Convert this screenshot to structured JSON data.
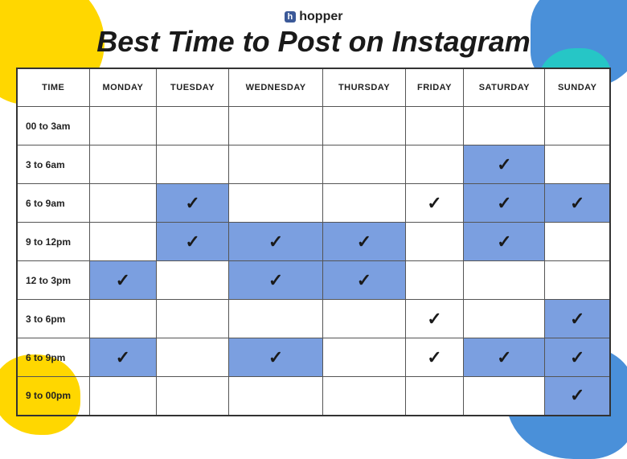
{
  "brand": {
    "icon_label": "h",
    "name": "hopper"
  },
  "title": "Best Time to Post on Instagram",
  "table": {
    "headers": [
      "TIME",
      "MONDAY",
      "TUESDAY",
      "WEDNESDAY",
      "THURSDAY",
      "FRIDAY",
      "SATURDAY",
      "SUNDAY"
    ],
    "rows": [
      {
        "time": "00 to 3am",
        "cells": [
          {
            "highlight": false,
            "check": false
          },
          {
            "highlight": false,
            "check": false
          },
          {
            "highlight": false,
            "check": false
          },
          {
            "highlight": false,
            "check": false
          },
          {
            "highlight": false,
            "check": false
          },
          {
            "highlight": false,
            "check": false
          },
          {
            "highlight": false,
            "check": false
          }
        ]
      },
      {
        "time": "3 to 6am",
        "cells": [
          {
            "highlight": false,
            "check": false
          },
          {
            "highlight": false,
            "check": false
          },
          {
            "highlight": false,
            "check": false
          },
          {
            "highlight": false,
            "check": false
          },
          {
            "highlight": false,
            "check": false
          },
          {
            "highlight": true,
            "check": true
          },
          {
            "highlight": false,
            "check": false
          }
        ]
      },
      {
        "time": "6 to 9am",
        "cells": [
          {
            "highlight": false,
            "check": false
          },
          {
            "highlight": true,
            "check": true
          },
          {
            "highlight": false,
            "check": false
          },
          {
            "highlight": false,
            "check": false
          },
          {
            "highlight": false,
            "check": true
          },
          {
            "highlight": true,
            "check": true
          },
          {
            "highlight": true,
            "check": true
          }
        ]
      },
      {
        "time": "9 to 12pm",
        "cells": [
          {
            "highlight": false,
            "check": false
          },
          {
            "highlight": true,
            "check": true
          },
          {
            "highlight": true,
            "check": true
          },
          {
            "highlight": true,
            "check": true
          },
          {
            "highlight": false,
            "check": false
          },
          {
            "highlight": true,
            "check": true
          },
          {
            "highlight": false,
            "check": false
          }
        ]
      },
      {
        "time": "12 to 3pm",
        "cells": [
          {
            "highlight": true,
            "check": true
          },
          {
            "highlight": false,
            "check": false
          },
          {
            "highlight": true,
            "check": true
          },
          {
            "highlight": true,
            "check": true
          },
          {
            "highlight": false,
            "check": false
          },
          {
            "highlight": false,
            "check": false
          },
          {
            "highlight": false,
            "check": false
          }
        ]
      },
      {
        "time": "3 to 6pm",
        "cells": [
          {
            "highlight": false,
            "check": false
          },
          {
            "highlight": false,
            "check": false
          },
          {
            "highlight": false,
            "check": false
          },
          {
            "highlight": false,
            "check": false
          },
          {
            "highlight": false,
            "check": true
          },
          {
            "highlight": false,
            "check": false
          },
          {
            "highlight": true,
            "check": true
          }
        ]
      },
      {
        "time": "6 to 9pm",
        "cells": [
          {
            "highlight": true,
            "check": true
          },
          {
            "highlight": false,
            "check": false
          },
          {
            "highlight": true,
            "check": true
          },
          {
            "highlight": false,
            "check": false
          },
          {
            "highlight": false,
            "check": true
          },
          {
            "highlight": true,
            "check": true
          },
          {
            "highlight": true,
            "check": true
          }
        ]
      },
      {
        "time": "9 to 00pm",
        "cells": [
          {
            "highlight": false,
            "check": false
          },
          {
            "highlight": false,
            "check": false
          },
          {
            "highlight": false,
            "check": false
          },
          {
            "highlight": false,
            "check": false
          },
          {
            "highlight": false,
            "check": false
          },
          {
            "highlight": false,
            "check": false
          },
          {
            "highlight": true,
            "check": true
          }
        ]
      }
    ]
  }
}
